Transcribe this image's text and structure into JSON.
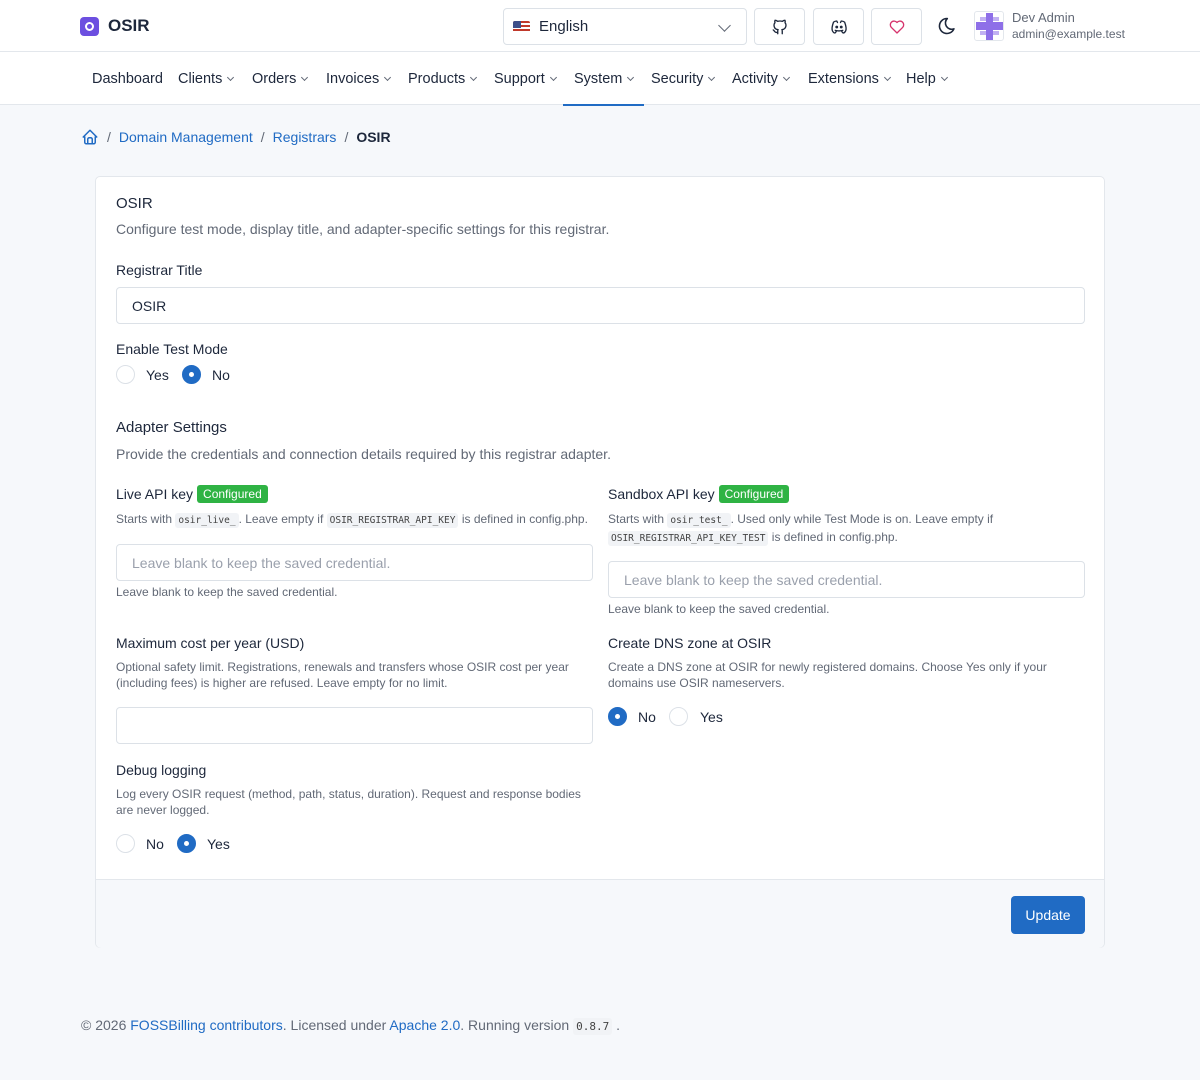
{
  "app": {
    "name": "OSIR",
    "language": "English",
    "user": {
      "name": "Dev Admin",
      "email": "admin@example.test"
    }
  },
  "nav": {
    "items": [
      {
        "label": "Dashboard",
        "dropdown": false
      },
      {
        "label": "Clients",
        "dropdown": true
      },
      {
        "label": "Orders",
        "dropdown": true
      },
      {
        "label": "Invoices",
        "dropdown": true
      },
      {
        "label": "Products",
        "dropdown": true
      },
      {
        "label": "Support",
        "dropdown": true
      },
      {
        "label": "System",
        "dropdown": true,
        "active": true
      },
      {
        "label": "Security",
        "dropdown": true
      },
      {
        "label": "Activity",
        "dropdown": true
      },
      {
        "label": "Extensions",
        "dropdown": true
      },
      {
        "label": "Help",
        "dropdown": true
      }
    ]
  },
  "breadcrumb": {
    "items": [
      "Domain Management",
      "Registrars"
    ],
    "current": "OSIR",
    "separator": "/"
  },
  "form": {
    "title": "OSIR",
    "subtitle": "Configure test mode, display title, and adapter-specific settings for this registrar.",
    "registrar_title": {
      "label": "Registrar Title",
      "value": "OSIR"
    },
    "test_mode": {
      "label": "Enable Test Mode",
      "options": [
        "Yes",
        "No"
      ],
      "selected": "No"
    },
    "adapter": {
      "title": "Adapter Settings",
      "subtitle": "Provide the credentials and connection details required by this registrar adapter.",
      "live_key": {
        "label": "Live API key",
        "badge": "Configured",
        "hint_prefix": "Starts with",
        "hint_code1": "osir_live_",
        "hint_mid": ". Leave empty if",
        "hint_code2": "OSIR_REGISTRAR_API_KEY",
        "hint_suffix": "is defined in config.php.",
        "placeholder": "Leave blank to keep the saved credential.",
        "help": "Leave blank to keep the saved credential."
      },
      "sandbox_key": {
        "label": "Sandbox API key",
        "badge": "Configured",
        "hint_prefix": "Starts with",
        "hint_code1": "osir_test_",
        "hint_mid": ". Used only while Test Mode is on. Leave empty if",
        "hint_code2": "OSIR_REGISTRAR_API_KEY_TEST",
        "hint_suffix": "is defined in config.php.",
        "placeholder": "Leave blank to keep the saved credential.",
        "help": "Leave blank to keep the saved credential."
      },
      "max_cost": {
        "label": "Maximum cost per year (USD)",
        "hint": "Optional safety limit. Registrations, renewals and transfers whose OSIR cost per year (including fees) is higher are refused. Leave empty for no limit.",
        "value": ""
      },
      "dns_zone": {
        "label": "Create DNS zone at OSIR",
        "hint": "Create a DNS zone at OSIR for newly registered domains. Choose Yes only if your domains use OSIR nameservers.",
        "options": [
          "No",
          "Yes"
        ],
        "selected": "No"
      },
      "debug": {
        "label": "Debug logging",
        "hint": "Log every OSIR request (method, path, status, duration). Request and response bodies are never logged.",
        "options": [
          "No",
          "Yes"
        ],
        "selected": "Yes"
      }
    },
    "submit_label": "Update"
  },
  "footer": {
    "copyright": "© 2026",
    "contributors": "FOSSBilling contributors",
    "licensed": ". Licensed under",
    "license": "Apache 2.0",
    "running": ". Running version",
    "version": "0.8.7",
    "end": "."
  },
  "colors": {
    "primary": "#206bc4",
    "brand": "#6c4fe0",
    "success": "#2fb344",
    "text": "#1d273b",
    "muted": "#626976"
  },
  "icons": [
    "app-logo-icon",
    "us-flag-icon",
    "chevron-down-icon",
    "github-icon",
    "discord-icon",
    "heart-icon",
    "moon-icon",
    "home-icon"
  ]
}
